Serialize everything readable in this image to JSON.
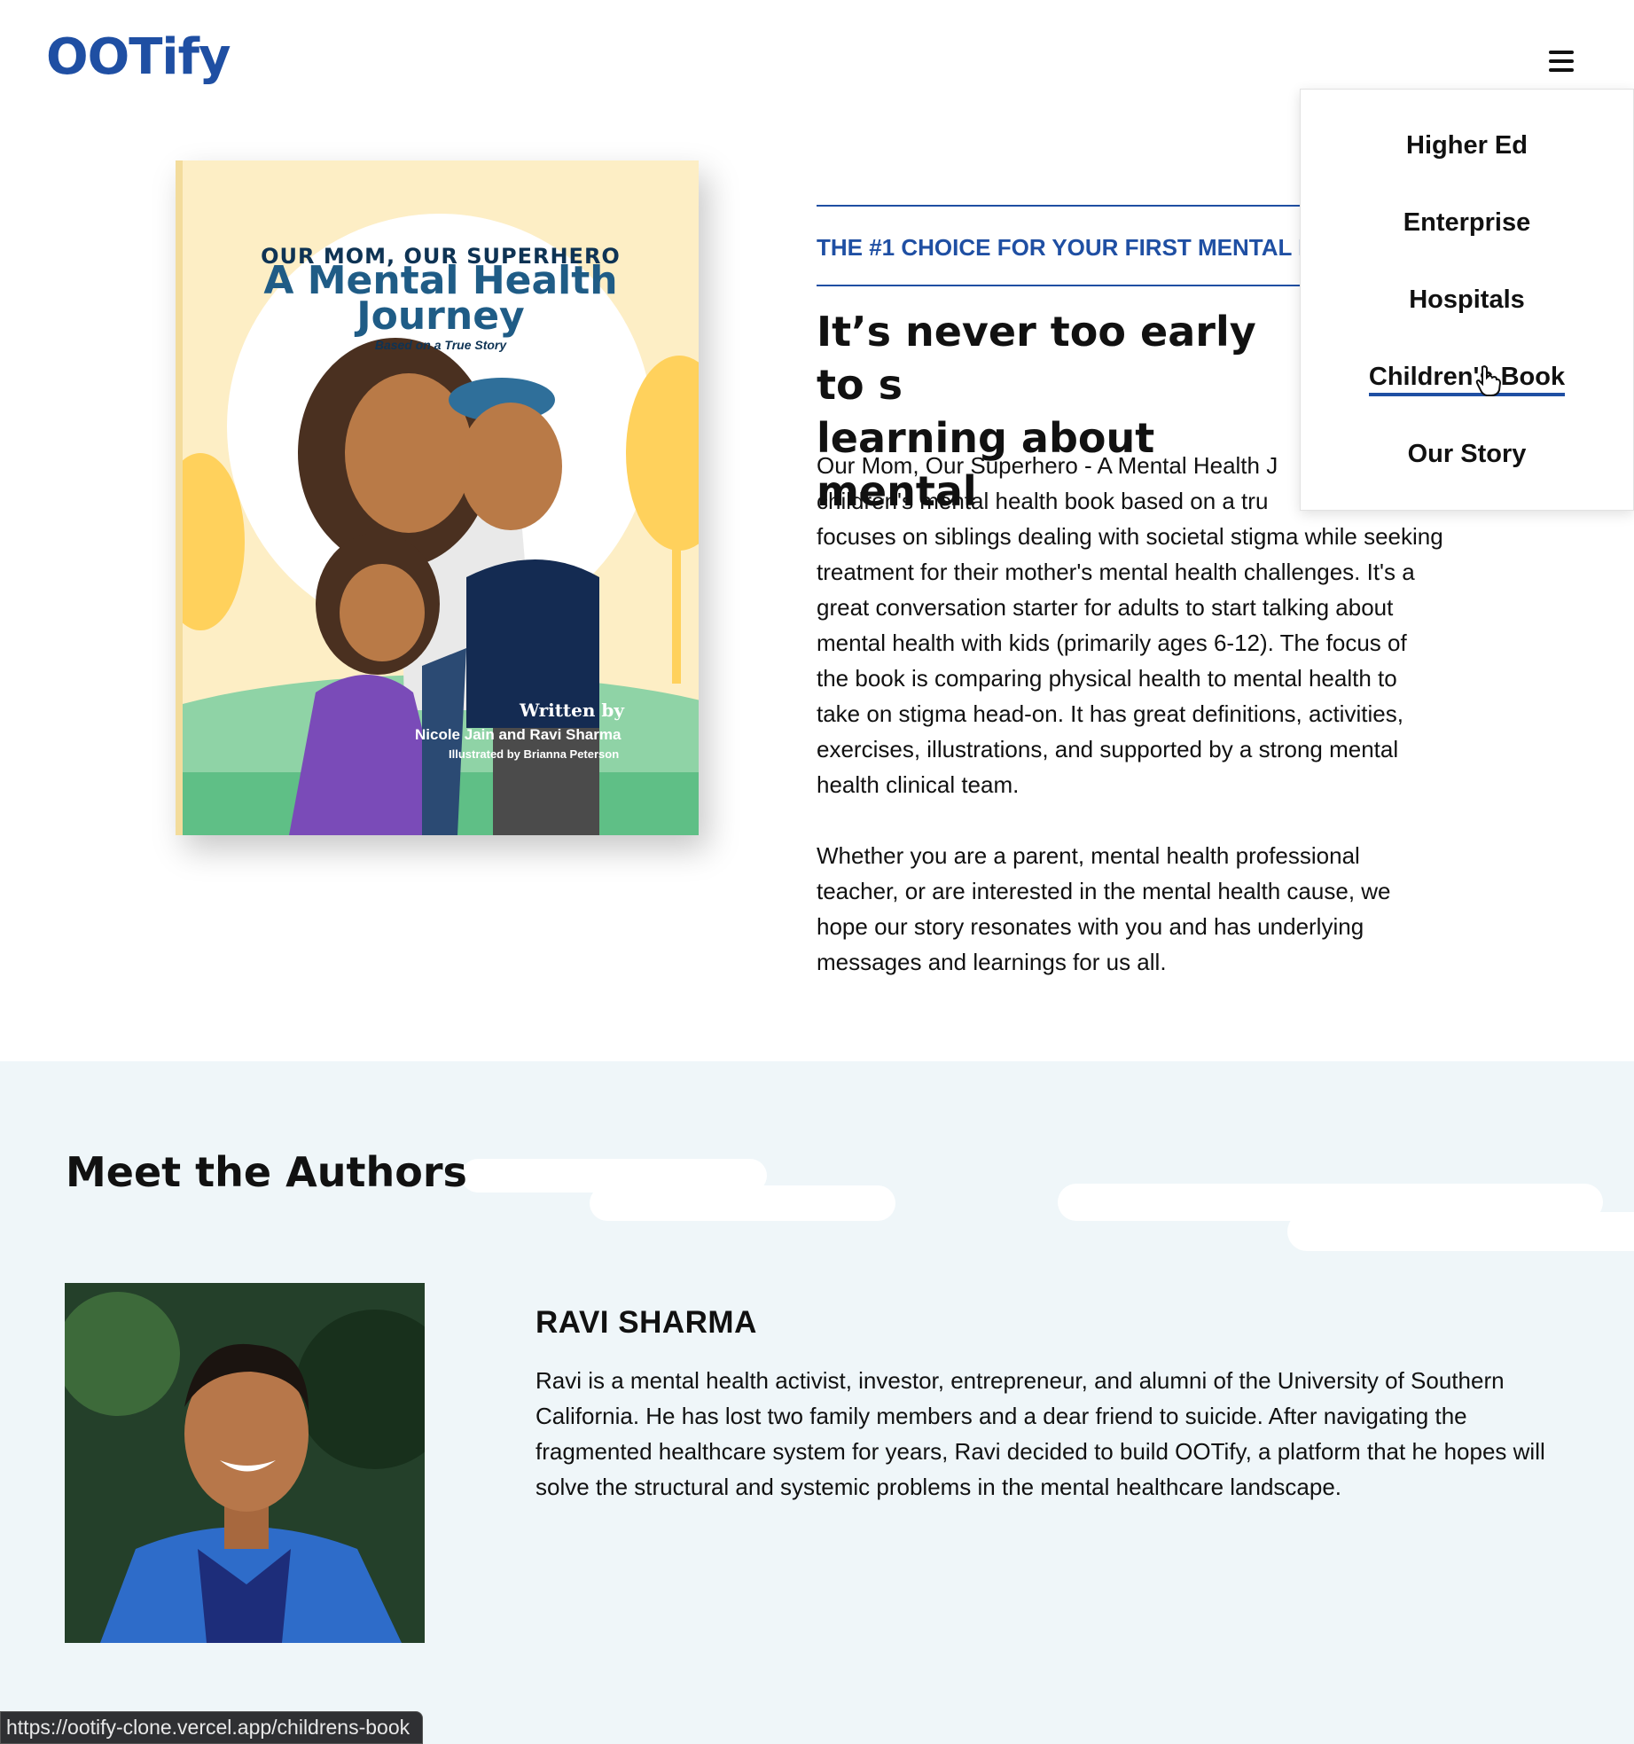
{
  "header": {
    "logo": "OOTify",
    "menu_icon": "hamburger-menu-icon"
  },
  "nav_menu": {
    "items": [
      {
        "label": "Higher Ed"
      },
      {
        "label": "Enterprise"
      },
      {
        "label": "Hospitals"
      },
      {
        "label": "Children's Book",
        "active": true
      },
      {
        "label": "Our Story"
      }
    ]
  },
  "book_cover": {
    "series": "OUR MOM, OUR SUPERHERO",
    "title_line1": "A Mental Health",
    "title_line2": "Journey",
    "subtitle": "Based on a True Story",
    "written_by": "Written by",
    "authors": "Nicole Jain and Ravi Sharma",
    "illustrator": "Illustrated by Brianna Peterson"
  },
  "hero": {
    "eyebrow": "THE #1 CHOICE FOR YOUR FIRST MENTAL I",
    "headline_line1": "It’s never too early to s",
    "headline_line2": "learning about mental",
    "paragraph1_lines": [
      "Our Mom, Our Superhero - A Mental Health J",
      "children's mental health book based on a tru",
      "focuses on siblings dealing with societal stigma while seeking",
      "treatment for their mother's mental health challenges. It's a",
      "great conversation starter for adults to start talking about",
      "mental health with kids (primarily ages 6-12). The focus of",
      "the book is comparing physical health to mental health to",
      "take on stigma head-on. It has great definitions, activities,",
      "exercises, illustrations, and supported by a strong mental",
      "health clinical team."
    ],
    "paragraph2_lines": [
      "Whether you are a parent, mental health professional",
      "teacher, or are interested in the mental health cause, we",
      "hope our story resonates with you and has underlying",
      "messages and learnings for us all."
    ]
  },
  "authors_section": {
    "title": "Meet the Authors",
    "author": {
      "name": "RAVI SHARMA",
      "bio": "Ravi is a mental health activist, investor, entrepreneur, and alumni of the University of Southern California. He has lost two family members and a dear friend to suicide. After navigating the fragmented healthcare system for years, Ravi decided to build OOTify, a platform that he hopes will solve the structural and systemic problems in the mental healthcare landscape."
    }
  },
  "status_bar": {
    "url": "https://ootify-clone.vercel.app/childrens-book"
  },
  "colors": {
    "brand_blue": "#1f4fa3",
    "section_bg": "#eff6f9",
    "text": "#111111"
  }
}
